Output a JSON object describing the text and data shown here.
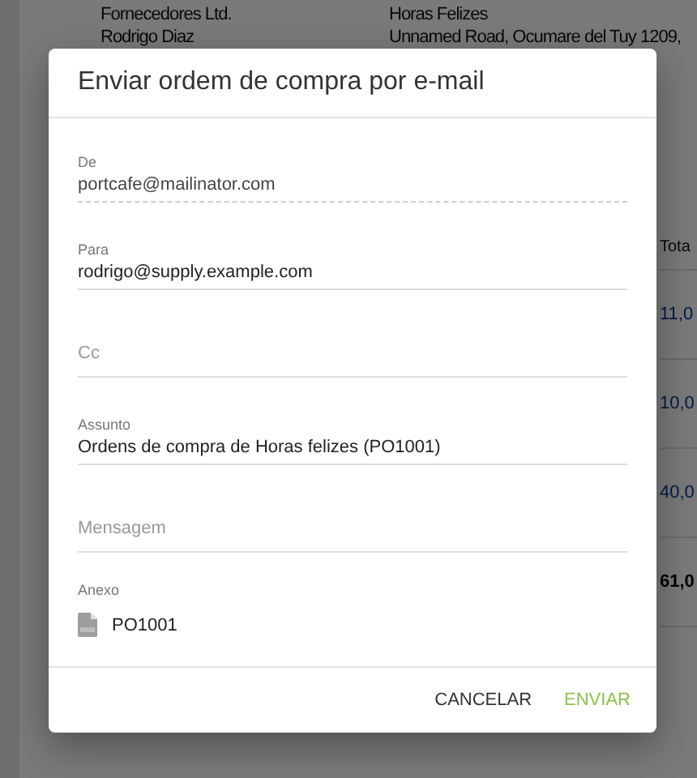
{
  "background": {
    "left_lines": [
      "Fornecedores Ltd.",
      "Rodrigo Diaz"
    ],
    "right_lines": [
      "Horas Felizes",
      "Unnamed Road, Ocumare del Tuy 1209,"
    ],
    "table": {
      "header": "Tota",
      "cells": [
        "11,0",
        "10,0",
        "40,0",
        "61,0"
      ]
    }
  },
  "dialog": {
    "title": "Enviar ordem de compra por e-mail",
    "fields": [
      {
        "label": "De",
        "value": "portcafe@mailinator.com",
        "disabled": true
      },
      {
        "label": "Para",
        "value": "rodrigo@supply.example.com",
        "disabled": false
      },
      {
        "placeholder": "Cc",
        "disabled": false
      },
      {
        "label": "Assunto",
        "value": "Ordens de compra de Horas felizes (PO1001)",
        "disabled": false
      },
      {
        "placeholder": "Mensagem",
        "disabled": false
      }
    ],
    "attachment": {
      "label": "Anexo",
      "file": "PO1001"
    },
    "buttons": [
      {
        "label": "CANCELAR",
        "kind": "secondary"
      },
      {
        "label": "ENVIAR",
        "kind": "primary"
      }
    ]
  }
}
